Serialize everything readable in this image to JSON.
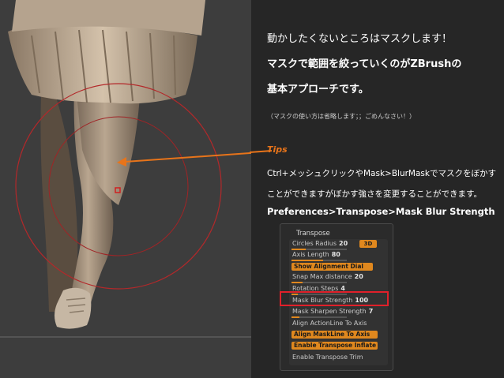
{
  "description_lines": {
    "line1": "動かしたくないところはマスクします！",
    "line2": "マスクで範囲を絞っていくのがZBrushの",
    "line3": "基本アプローチです。",
    "note": "（マスクの使い方は省略します；；ごめんなさい！）",
    "tips": "Tips",
    "line4": "Ctrl+メッシュクリックやMask>BlurMaskでマスクをぼかす",
    "line5": "ことができますがぼかす強さを変更することができます。",
    "line6": "Preferences>Transpose>Mask Blur Strength"
  },
  "panel": {
    "title": "Transpose",
    "circles_radius_label": "Circles Radius",
    "circles_radius_value": "20",
    "badge": "3D",
    "axis_length_label": "Axis Length",
    "axis_length_value": "80",
    "show_alignment_dial": "Show Alignment Dial",
    "snap_max_distance_label": "Snap Max distance",
    "snap_max_distance_value": "20",
    "rotation_steps_label": "Rotation Steps",
    "rotation_steps_value": "4",
    "mask_blur_strength_label": "Mask Blur Strength",
    "mask_blur_strength_value": "100",
    "mask_sharpen_strength_label": "Mask Sharpen Strength",
    "mask_sharpen_strength_value": "7",
    "align_actionline": "Align ActionLine To Axis",
    "align_maskline": "Align MaskLine To Axis",
    "enable_transpose_inflate": "Enable Transpose Inflate",
    "enable_transpose_trim": "Enable Transpose Trim"
  },
  "colors": {
    "accent": "#e0881e",
    "highlight": "#e0202a",
    "background": "#262626"
  }
}
